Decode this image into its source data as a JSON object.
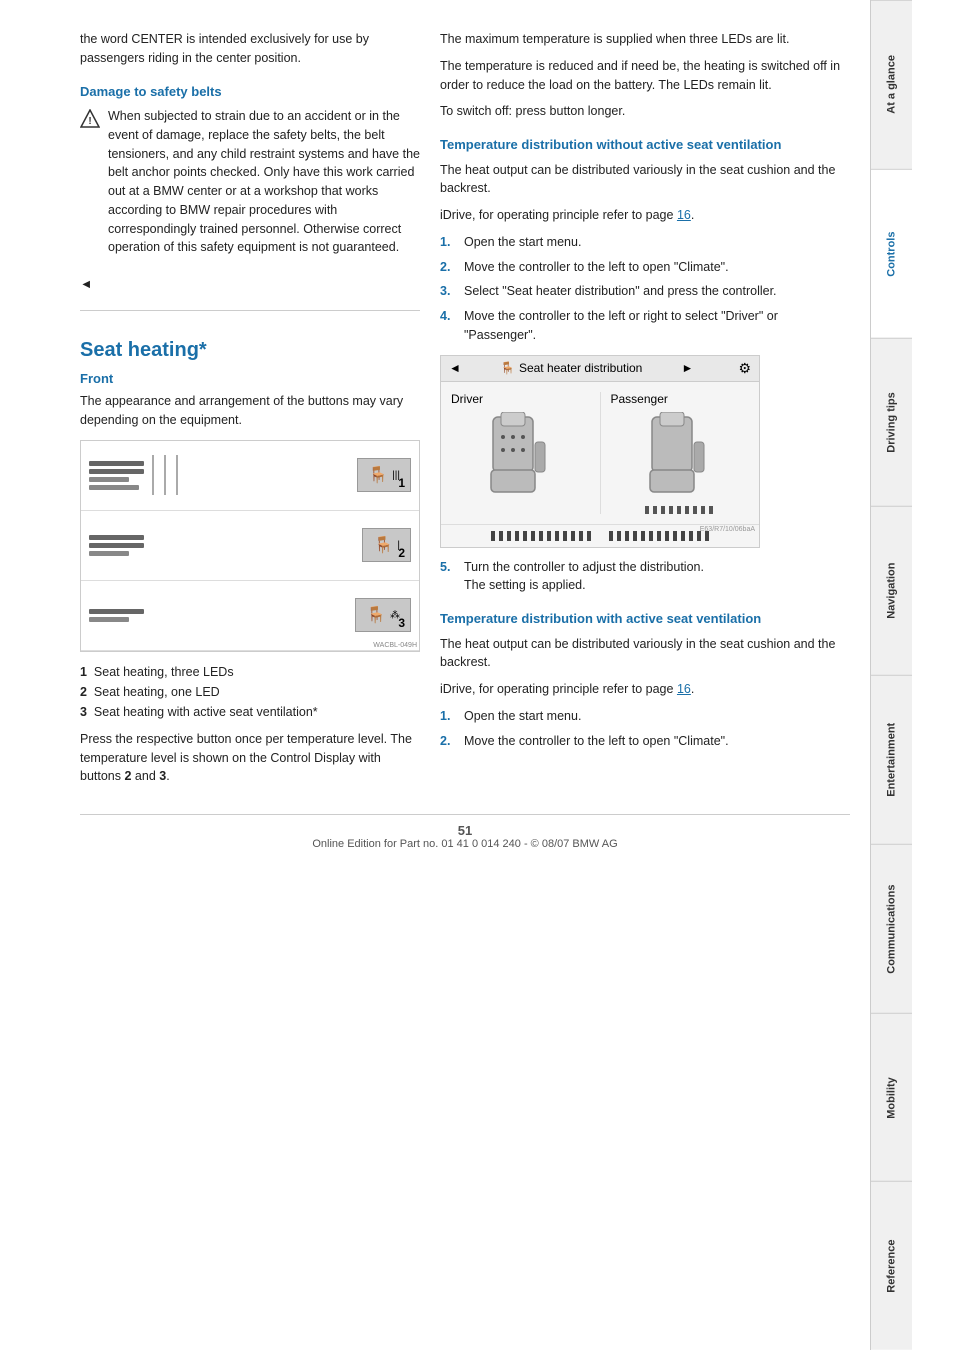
{
  "sidebar": {
    "tabs": [
      {
        "id": "at-a-glance",
        "label": "At a glance",
        "active": false
      },
      {
        "id": "controls",
        "label": "Controls",
        "active": true
      },
      {
        "id": "driving-tips",
        "label": "Driving tips",
        "active": false
      },
      {
        "id": "navigation",
        "label": "Navigation",
        "active": false
      },
      {
        "id": "entertainment",
        "label": "Entertainment",
        "active": false
      },
      {
        "id": "communications",
        "label": "Communications",
        "active": false
      },
      {
        "id": "mobility",
        "label": "Mobility",
        "active": false
      },
      {
        "id": "reference",
        "label": "Reference",
        "active": false
      }
    ]
  },
  "left_col": {
    "intro_text": "the word CENTER is intended exclusively for use by passengers riding in the center position.",
    "damage_heading": "Damage to safety belts",
    "damage_text": "When subjected to strain due to an accident or in the event of damage, replace the safety belts, the belt tensioners, and any child restraint systems and have the belt anchor points checked. Only have this work carried out at a BMW center or at a workshop that works according to BMW repair procedures with correspondingly trained personnel. Otherwise correct operation of this safety equipment is not guaranteed.",
    "damage_end": "◄",
    "seat_heading": "Seat heating*",
    "front_heading": "Front",
    "front_text": "The appearance and arrangement of the buttons may vary depending on the equipment.",
    "legend_items": [
      {
        "num": "1",
        "text": "Seat heating, three LEDs"
      },
      {
        "num": "2",
        "text": "Seat heating, one LED"
      },
      {
        "num": "3",
        "text": "Seat heating with active seat ventilation",
        "asterisk": "*"
      }
    ],
    "press_text_bold_prefix": "Press the respective button once per temperature level. The temperature level is shown on the Control Display with buttons ",
    "press_text_b1": "2",
    "press_text_and": " and ",
    "press_text_b2": "3",
    "press_text_end": ".",
    "watermark": "WACBL-049H"
  },
  "right_col": {
    "max_temp_text": "The maximum temperature is supplied when three LEDs are lit.",
    "reduce_text": "The temperature is reduced and if need be, the heating is switched off in order to reduce the load on the battery. The LEDs remain lit.",
    "switch_off_text": "To switch off: press button longer.",
    "without_vent_heading": "Temperature distribution without active seat ventilation",
    "without_vent_body": "The heat output can be distributed variously in the seat cushion and the backrest.",
    "without_vent_idrive": "iDrive, for operating principle refer to page",
    "without_vent_page": "16",
    "without_vent_steps": [
      {
        "num": "1",
        "text": "Open the start menu."
      },
      {
        "num": "2",
        "text": "Move the controller to the left to open \"Climate\"."
      },
      {
        "num": "3",
        "text": "Select \"Seat heater distribution\" and press the controller."
      },
      {
        "num": "4",
        "text": "Move the controller to the left or right to select \"Driver\" or \"Passenger\"."
      }
    ],
    "seat_dist_ui": {
      "title": "Seat heater distribution",
      "driver_label": "Driver",
      "passenger_label": "Passenger",
      "watermark": "E63/R7/10/06baA"
    },
    "step5": {
      "num": "5",
      "text": "Turn the controller to adjust the distribution.\nThe setting is applied."
    },
    "with_vent_heading": "Temperature distribution with active seat ventilation",
    "with_vent_body": "The heat output can be distributed variously in the seat cushion and the backrest.",
    "with_vent_idrive": "iDrive, for operating principle refer to page",
    "with_vent_page": "16",
    "with_vent_steps": [
      {
        "num": "1",
        "text": "Open the start menu."
      },
      {
        "num": "2",
        "text": "Move the controller to the left to open \"Climate\"."
      }
    ]
  },
  "footer": {
    "page_num": "51",
    "copyright": "Online Edition for Part no. 01 41 0 014 240 - © 08/07 BMW AG"
  }
}
